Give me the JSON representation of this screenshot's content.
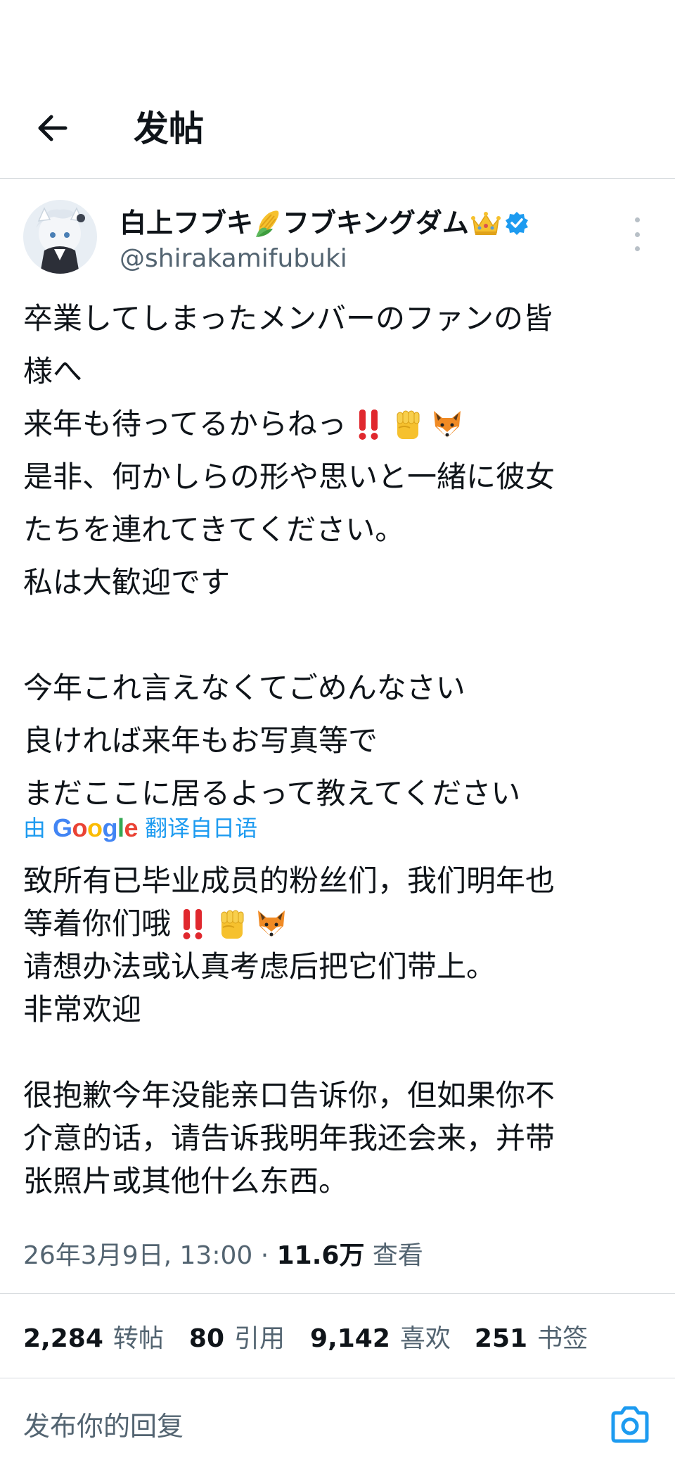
{
  "header": {
    "title": "发帖"
  },
  "author": {
    "display_name_part1": "白上フブキ",
    "display_name_part2": "フブキングダム",
    "handle": "@shirakamifubuki",
    "verified_color": "#1d9bf0"
  },
  "tweet": {
    "lines": [
      "卒業してしまったメンバーのファンの皆",
      "様へ",
      "来年も待ってるからねっ",
      "是非、何かしらの形や思いと一緒に彼女",
      "たちを連れてきてください。",
      "私は大歓迎です",
      "",
      "今年これ言えなくてごめんなさい",
      "良ければ来年もお写真等で",
      "まだここに居るよって教えてください"
    ]
  },
  "translation": {
    "prefix": "由",
    "provider": "Google",
    "suffix": "翻译自日语",
    "lines": [
      "致所有已毕业成员的粉丝们，我们明年也",
      "等着你们哦",
      "请想办法或认真考虑后把它们带上。",
      "非常欢迎",
      "",
      "很抱歉今年没能亲口告诉你，但如果你不",
      "介意的话，请告诉我明年我还会来，并带",
      "张照片或其他什么东西。"
    ]
  },
  "meta": {
    "date": "26年3月9日, 13:00",
    "separator": "·",
    "views": "11.6万",
    "views_label": "查看"
  },
  "stats": {
    "reposts": "2,284",
    "reposts_label": "转帖",
    "quotes": "80",
    "quotes_label": "引用",
    "likes": "9,142",
    "likes_label": "喜欢",
    "bookmarks": "251",
    "bookmarks_label": "书签"
  },
  "reply": {
    "placeholder": "发布你的回复"
  },
  "colors": {
    "accent": "#1d9bf0",
    "secondary_text": "#536471",
    "divider": "#d6dade"
  }
}
